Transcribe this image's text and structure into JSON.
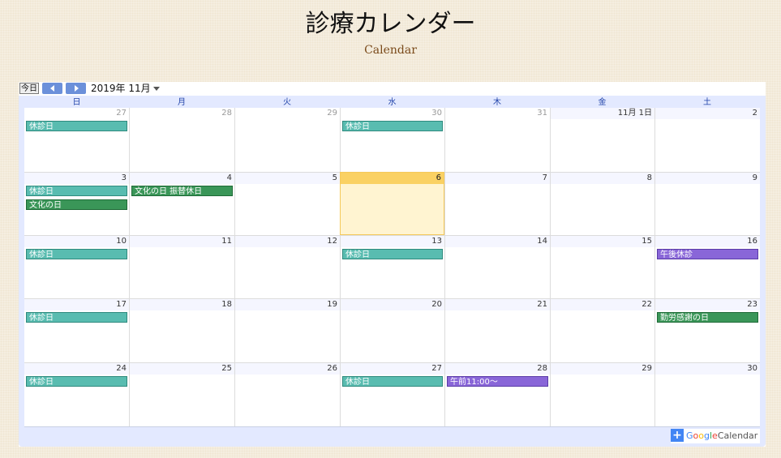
{
  "page": {
    "title": "診療カレンダー",
    "subtitle": "Calendar"
  },
  "toolbar": {
    "today_label": "今日",
    "month_label": "2019年 11月"
  },
  "weekdays": [
    "日",
    "月",
    "火",
    "水",
    "木",
    "金",
    "土"
  ],
  "weeks": [
    [
      {
        "label": "27",
        "other": true,
        "events": [
          {
            "text": "休診日",
            "color": "teal"
          }
        ]
      },
      {
        "label": "28",
        "other": true,
        "events": []
      },
      {
        "label": "29",
        "other": true,
        "events": []
      },
      {
        "label": "30",
        "other": true,
        "events": [
          {
            "text": "休診日",
            "color": "teal"
          }
        ]
      },
      {
        "label": "31",
        "other": true,
        "events": []
      },
      {
        "label": "11月 1日",
        "events": []
      },
      {
        "label": "2",
        "events": []
      }
    ],
    [
      {
        "label": "3",
        "events": [
          {
            "text": "休診日",
            "color": "teal"
          },
          {
            "text": "文化の日",
            "color": "green"
          }
        ]
      },
      {
        "label": "4",
        "events": [
          {
            "text": "文化の日 振替休日",
            "color": "green"
          }
        ]
      },
      {
        "label": "5",
        "events": []
      },
      {
        "label": "6",
        "today": true,
        "events": []
      },
      {
        "label": "7",
        "events": []
      },
      {
        "label": "8",
        "events": []
      },
      {
        "label": "9",
        "events": []
      }
    ],
    [
      {
        "label": "10",
        "events": [
          {
            "text": "休診日",
            "color": "teal"
          }
        ]
      },
      {
        "label": "11",
        "events": []
      },
      {
        "label": "12",
        "events": []
      },
      {
        "label": "13",
        "events": [
          {
            "text": "休診日",
            "color": "teal"
          }
        ]
      },
      {
        "label": "14",
        "events": []
      },
      {
        "label": "15",
        "events": []
      },
      {
        "label": "16",
        "events": [
          {
            "text": "午後休診",
            "color": "purple"
          }
        ]
      }
    ],
    [
      {
        "label": "17",
        "events": [
          {
            "text": "休診日",
            "color": "teal"
          }
        ]
      },
      {
        "label": "18",
        "events": []
      },
      {
        "label": "19",
        "events": []
      },
      {
        "label": "20",
        "events": []
      },
      {
        "label": "21",
        "events": []
      },
      {
        "label": "22",
        "events": []
      },
      {
        "label": "23",
        "events": [
          {
            "text": "勤労感謝の日",
            "color": "green"
          }
        ]
      }
    ],
    [
      {
        "label": "24",
        "events": [
          {
            "text": "休診日",
            "color": "teal"
          }
        ]
      },
      {
        "label": "25",
        "events": []
      },
      {
        "label": "26",
        "events": []
      },
      {
        "label": "27",
        "events": [
          {
            "text": "休診日",
            "color": "teal"
          }
        ]
      },
      {
        "label": "28",
        "events": [
          {
            "text": "午前11:00〜",
            "color": "purple"
          }
        ]
      },
      {
        "label": "29",
        "events": []
      },
      {
        "label": "30",
        "events": []
      }
    ]
  ],
  "footer": {
    "google": "Google",
    "calendar": "Calendar",
    "plus": "+"
  },
  "icons": {
    "prev": "triangle-left-icon",
    "next": "triangle-right-icon",
    "dropdown": "caret-down-icon",
    "add": "plus-icon"
  },
  "colors": {
    "teal": "#59bcb0",
    "green": "#3a9658",
    "purple": "#8966d8",
    "today": "#fad163"
  }
}
